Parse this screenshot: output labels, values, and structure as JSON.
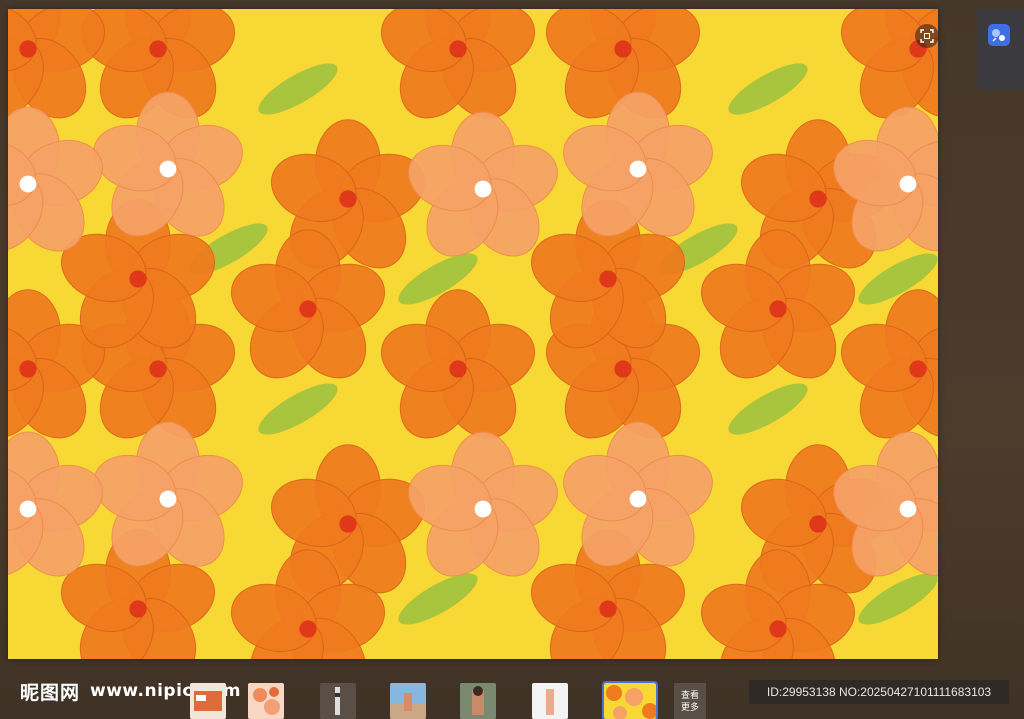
{
  "viewer": {
    "image_name": "orange-hibiscus-pattern",
    "colors": {
      "background": "#f7d834",
      "petal_dark": "#f07a1e",
      "petal_light": "#f6a267",
      "leaf": "#9bc23f",
      "center": "#e0391a"
    }
  },
  "toolbar": {
    "fullscreen_icon": "fullscreen-icon"
  },
  "side_panel": {
    "icon": "sparkle-app-icon"
  },
  "footer": {
    "logo_text": "昵图网",
    "logo_url": "www.nipic.com",
    "more_label_1": "查看",
    "more_label_2": "更多",
    "id_text": "ID:29953138 NO:20250427101111683103",
    "thumbnails": [
      {
        "name": "thumb-1",
        "active": false
      },
      {
        "name": "thumb-2",
        "active": false
      },
      {
        "name": "thumb-3",
        "active": false
      },
      {
        "name": "thumb-4",
        "active": false
      },
      {
        "name": "thumb-5",
        "active": false
      },
      {
        "name": "thumb-6",
        "active": false
      },
      {
        "name": "thumb-7",
        "active": true
      }
    ]
  }
}
